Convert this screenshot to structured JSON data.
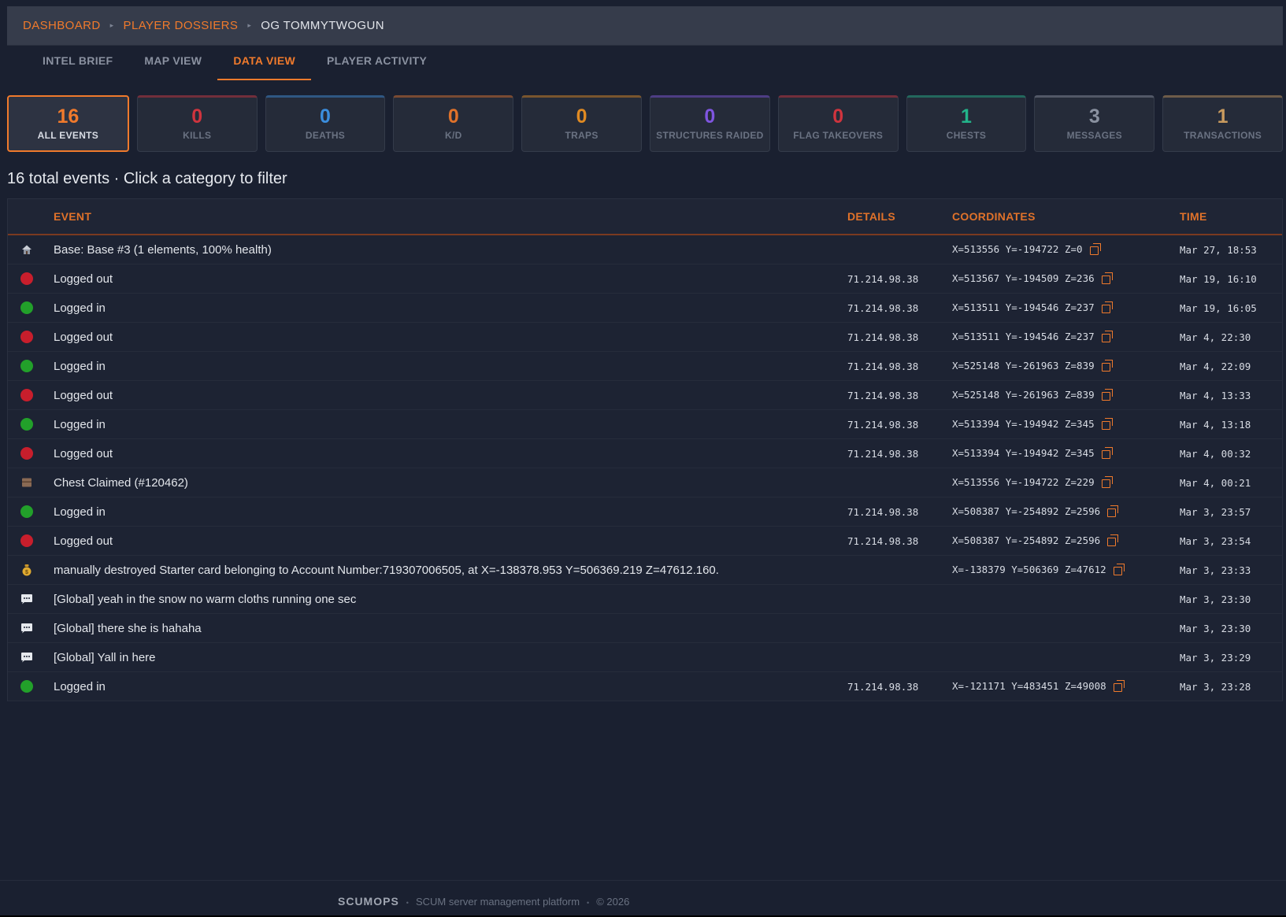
{
  "breadcrumb": {
    "items": [
      {
        "label": "DASHBOARD"
      },
      {
        "label": "PLAYER DOSSIERS"
      }
    ],
    "current": "OG TOMMYTWOGUN",
    "separator": "▸"
  },
  "tabs": [
    {
      "label": "INTEL BRIEF",
      "active": false
    },
    {
      "label": "MAP VIEW",
      "active": false
    },
    {
      "label": "DATA VIEW",
      "active": true
    },
    {
      "label": "PLAYER ACTIVITY",
      "active": false
    }
  ],
  "stat_cards": [
    {
      "value": "16",
      "label": "ALL EVENTS",
      "color": "#f07a2c",
      "active": true
    },
    {
      "value": "0",
      "label": "KILLS",
      "color": "#d0343e",
      "active": false
    },
    {
      "value": "0",
      "label": "DEATHS",
      "color": "#3b8ede",
      "active": false
    },
    {
      "value": "0",
      "label": "K/D",
      "color": "#e0722a",
      "active": false
    },
    {
      "value": "0",
      "label": "TRAPS",
      "color": "#e08a22",
      "active": false
    },
    {
      "value": "0",
      "label": "STRUCTURES RAIDED",
      "color": "#7f55e0",
      "active": false
    },
    {
      "value": "0",
      "label": "FLAG TAKEOVERS",
      "color": "#d0343e",
      "active": false
    },
    {
      "value": "1",
      "label": "CHESTS",
      "color": "#22b48a",
      "active": false
    },
    {
      "value": "3",
      "label": "MESSAGES",
      "color": "#8a91a0",
      "active": false
    },
    {
      "value": "1",
      "label": "TRANSACTIONS",
      "color": "#c89a5e",
      "active": false
    }
  ],
  "summary": "16 total events · Click a category to filter",
  "table": {
    "headers": {
      "event": "EVENT",
      "details": "DETAILS",
      "coordinates": "COORDINATES",
      "time": "TIME"
    },
    "rows": [
      {
        "icon": "base-icon",
        "event": "Base: Base #3 (1 elements, 100% health)",
        "details": "",
        "coords": "X=513556 Y=-194722 Z=0",
        "time": "Mar 27, 18:53"
      },
      {
        "icon": "logout-dot-icon",
        "event": "Logged out",
        "details": "71.214.98.38",
        "coords": "X=513567 Y=-194509 Z=236",
        "time": "Mar 19, 16:10"
      },
      {
        "icon": "login-dot-icon",
        "event": "Logged in",
        "details": "71.214.98.38",
        "coords": "X=513511 Y=-194546 Z=237",
        "time": "Mar 19, 16:05"
      },
      {
        "icon": "logout-dot-icon",
        "event": "Logged out",
        "details": "71.214.98.38",
        "coords": "X=513511 Y=-194546 Z=237",
        "time": "Mar 4, 22:30"
      },
      {
        "icon": "login-dot-icon",
        "event": "Logged in",
        "details": "71.214.98.38",
        "coords": "X=525148 Y=-261963 Z=839",
        "time": "Mar 4, 22:09"
      },
      {
        "icon": "logout-dot-icon",
        "event": "Logged out",
        "details": "71.214.98.38",
        "coords": "X=525148 Y=-261963 Z=839",
        "time": "Mar 4, 13:33"
      },
      {
        "icon": "login-dot-icon",
        "event": "Logged in",
        "details": "71.214.98.38",
        "coords": "X=513394 Y=-194942 Z=345",
        "time": "Mar 4, 13:18"
      },
      {
        "icon": "logout-dot-icon",
        "event": "Logged out",
        "details": "71.214.98.38",
        "coords": "X=513394 Y=-194942 Z=345",
        "time": "Mar 4, 00:32"
      },
      {
        "icon": "chest-icon",
        "event": "Chest Claimed (#120462)",
        "details": "",
        "coords": "X=513556 Y=-194722 Z=229",
        "time": "Mar 4, 00:21"
      },
      {
        "icon": "login-dot-icon",
        "event": "Logged in",
        "details": "71.214.98.38",
        "coords": "X=508387 Y=-254892 Z=2596",
        "time": "Mar 3, 23:57"
      },
      {
        "icon": "logout-dot-icon",
        "event": "Logged out",
        "details": "71.214.98.38",
        "coords": "X=508387 Y=-254892 Z=2596",
        "time": "Mar 3, 23:54"
      },
      {
        "icon": "money-bag-icon",
        "event": "manually destroyed Starter card belonging to Account Number:719307006505, at X=-138378.953 Y=506369.219 Z=47612.160.",
        "details": "",
        "coords": "X=-138379 Y=506369 Z=47612",
        "time": "Mar 3, 23:33"
      },
      {
        "icon": "chat-icon",
        "event": "[Global] yeah in the snow no warm cloths running one sec",
        "details": "",
        "coords": "",
        "time": "Mar 3, 23:30"
      },
      {
        "icon": "chat-icon",
        "event": "[Global] there she is hahaha",
        "details": "",
        "coords": "",
        "time": "Mar 3, 23:30"
      },
      {
        "icon": "chat-icon",
        "event": "[Global] Yall in here",
        "details": "",
        "coords": "",
        "time": "Mar 3, 23:29"
      },
      {
        "icon": "login-dot-icon",
        "event": "Logged in",
        "details": "71.214.98.38",
        "coords": "X=-121171 Y=483451 Z=49008",
        "time": "Mar 3, 23:28"
      }
    ]
  },
  "footer": {
    "brand": "SCUMOPS",
    "tagline": "SCUM server management platform",
    "copyright": "© 2026",
    "separator": "•"
  }
}
